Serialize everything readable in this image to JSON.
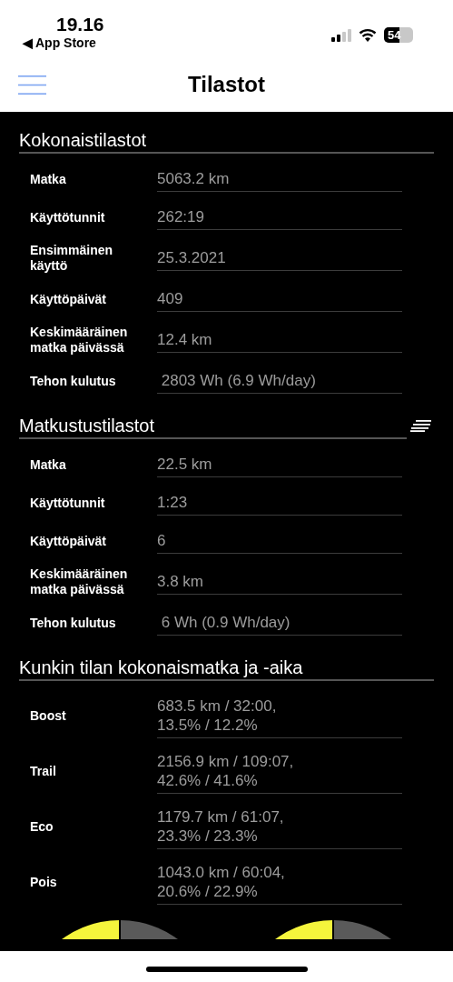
{
  "status_bar": {
    "time": "19.16",
    "back_link": "◀ App Store",
    "battery": "54"
  },
  "nav": {
    "title": "Tilastot"
  },
  "sections": [
    {
      "title": "Kokonaistilastot",
      "sortable": false,
      "rows": [
        {
          "label": "Matka",
          "value": "5063.2 km"
        },
        {
          "label": "Käyttötunnit",
          "value": "262:19"
        },
        {
          "label": "Ensimmäinen käyttö",
          "value": "25.3.2021"
        },
        {
          "label": "Käyttöpäivät",
          "value": "409"
        },
        {
          "label": "Keskimääräinen matka päivässä",
          "value": "12.4 km"
        },
        {
          "label": "Tehon kulutus",
          "value": " 2803 Wh (6.9 Wh/day)"
        }
      ]
    },
    {
      "title": "Matkustustilastot",
      "sortable": true,
      "rows": [
        {
          "label": "Matka",
          "value": "22.5 km"
        },
        {
          "label": "Käyttötunnit",
          "value": "1:23"
        },
        {
          "label": "Käyttöpäivät",
          "value": "6"
        },
        {
          "label": "Keskimääräinen matka päivässä",
          "value": "3.8 km"
        },
        {
          "label": "Tehon kulutus",
          "value": " 6 Wh (0.9 Wh/day)"
        }
      ]
    },
    {
      "title": "Kunkin tilan kokonaismatka ja -aika",
      "sortable": false,
      "rows": [
        {
          "label": "Boost",
          "value": "683.5 km / 32:00,\n13.5% / 12.2%"
        },
        {
          "label": "Trail",
          "value": "2156.9 km / 109:07,\n42.6% / 41.6%"
        },
        {
          "label": "Eco",
          "value": "1179.7 km / 61:07,\n23.3% / 23.3%"
        },
        {
          "label": "Pois",
          "value": "1043.0 km / 60:04,\n20.6% / 22.9%"
        }
      ]
    }
  ]
}
